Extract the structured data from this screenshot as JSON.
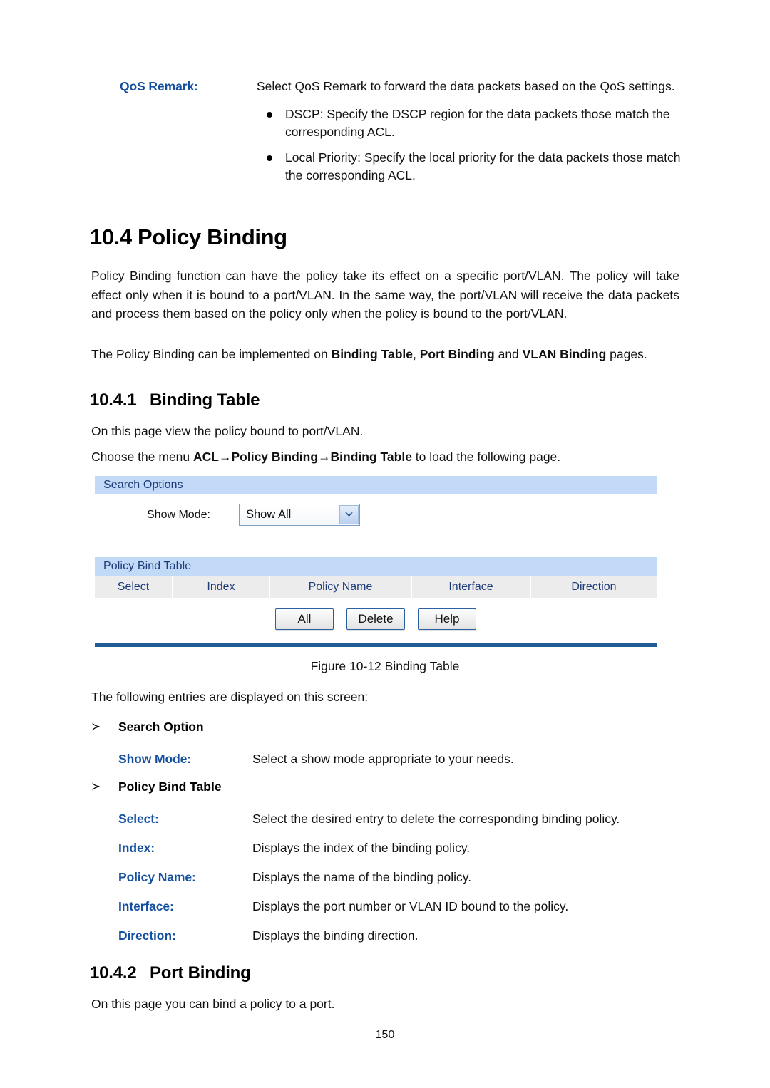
{
  "qos_remark": {
    "label": "QoS Remark:",
    "intro": "Select QoS Remark to forward the data packets based on the QoS settings.",
    "bullets": [
      "DSCP: Specify the DSCP region for the data packets those match the corresponding ACL.",
      "Local Priority: Specify the local priority for the data packets those match the corresponding ACL."
    ]
  },
  "section": {
    "heading": "10.4 Policy Binding",
    "intro_paragraph": "Policy Binding function can have the policy take its effect on a specific port/VLAN. The policy will take effect only when it is bound to a port/VLAN. In the same way, the port/VLAN will receive the data packets and process them based on the policy only when the policy is bound to the port/VLAN.",
    "implemented_paragraph_parts": {
      "a": "The Policy Binding can be implemented on ",
      "b": "Binding Table",
      "c": ", ",
      "d": "Port Binding",
      "e": " and ",
      "f": "VLAN Binding",
      "g": " pages."
    }
  },
  "subsection_1": {
    "number": "10.4.1",
    "title": "Binding Table",
    "view_paragraph": "On this page view the policy bound to port/VLAN.",
    "menu_paragraph_parts": {
      "a": "Choose the menu ",
      "b": "ACL",
      "c": "→",
      "d": "Policy Binding",
      "e": "→",
      "f": "Binding Table",
      "g": " to load the following page."
    }
  },
  "figure": {
    "caption": "Figure 10-12 Binding Table",
    "search_options": {
      "panel_title": "Search Options",
      "show_mode_label": "Show Mode:",
      "show_mode_value": "Show All",
      "dropdown_icon": "chevron-down-icon"
    },
    "policy_bind_table": {
      "panel_title": "Policy Bind Table",
      "columns": [
        "Select",
        "Index",
        "Policy Name",
        "Interface",
        "Direction"
      ],
      "rows": []
    },
    "buttons": [
      "All",
      "Delete",
      "Help"
    ],
    "colors": {
      "panel_header_bg": "#c2d9f7",
      "panel_header_text": "#1f3c7a",
      "table_header_bg": "#ececec",
      "rule": "#205c93",
      "button_border": "#2a5fa0"
    }
  },
  "entries": {
    "intro": "The following entries are displayed on this screen:",
    "groups": [
      {
        "marker": "≻",
        "title": "Search Option",
        "items": [
          {
            "label": "Show Mode:",
            "desc": "Select a show mode appropriate to your needs."
          }
        ]
      },
      {
        "marker": "≻",
        "title": "Policy Bind Table",
        "items": [
          {
            "label": "Select:",
            "desc": "Select the desired entry to delete the corresponding binding policy."
          },
          {
            "label": "Index:",
            "desc": "Displays the index of the binding policy."
          },
          {
            "label": "Policy Name:",
            "desc": "Displays the name of the binding policy."
          },
          {
            "label": "Interface:",
            "desc": "Displays the port number or VLAN ID bound to the policy."
          },
          {
            "label": "Direction:",
            "desc": "Displays the binding direction."
          }
        ]
      }
    ]
  },
  "subsection_2": {
    "number": "10.4.2",
    "title": "Port Binding",
    "paragraph": "On this page you can bind a policy to a port."
  },
  "page_number": "150",
  "accent_colors": {
    "definition_label": "#14509f",
    "body_text": "#111111"
  }
}
